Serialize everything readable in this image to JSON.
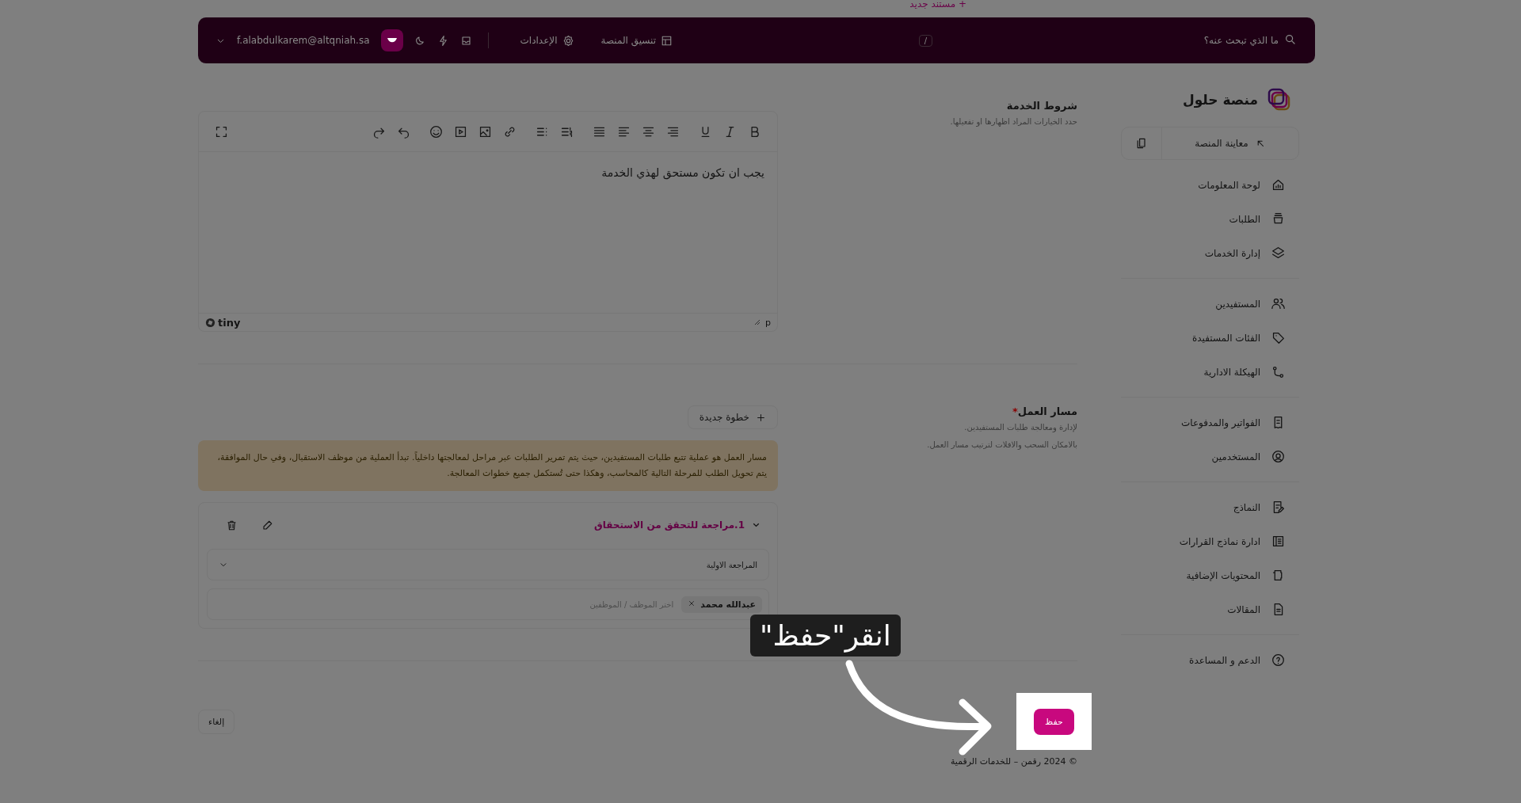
{
  "top_link": {
    "label": "مستند جديد",
    "icon": "+"
  },
  "topbar": {
    "search_placeholder": "ما الذي تبحث عنه؟",
    "shortcut": "/",
    "links": [
      {
        "label": "تنسيق المنصة",
        "kind": "layout"
      },
      {
        "label": "الإعدادات",
        "kind": "settings"
      }
    ],
    "email": "f.alabdulkarem@altqniah.sa"
  },
  "sidebar": {
    "brand": "منصة حلول",
    "preview": "معاينة المنصة",
    "groups": [
      [
        {
          "label": "لوحة المعلومات",
          "kind": "dashboard"
        },
        {
          "label": "الطلبات",
          "kind": "requests"
        },
        {
          "label": "إدارة الخدمات",
          "kind": "services"
        }
      ],
      [
        {
          "label": "المستفيدين",
          "kind": "users"
        },
        {
          "label": "الفئات المستفيدة",
          "kind": "tag"
        },
        {
          "label": "الهيكلة الادارية",
          "kind": "structure"
        }
      ],
      [
        {
          "label": "الفواتير والمدفوعات",
          "kind": "invoice"
        },
        {
          "label": "المستخدمين",
          "kind": "user"
        }
      ],
      [
        {
          "label": "النماذج",
          "kind": "forms"
        },
        {
          "label": "ادارة نماذج القرارات",
          "kind": "decisions"
        },
        {
          "label": "المحتويات الإضافية",
          "kind": "content"
        },
        {
          "label": "المقالات",
          "kind": "articles"
        }
      ],
      [
        {
          "label": "الدعم و المساعدة",
          "kind": "help"
        }
      ]
    ]
  },
  "terms": {
    "title": "شروط الخدمة",
    "subtitle": "حدد الخيارات المراد اظهارها او تفعيلها.",
    "content": "يجب ان تكون مستحق لهذي الخدمة",
    "status_path": "p",
    "brand": "tiny"
  },
  "workflow": {
    "title": "مسار العمل",
    "required_mark": "*",
    "subtitle_lines": [
      "لإدارة ومعالجة طلبات المستفيدين.",
      "بالامكان السحب والافلات لترتيب مسار العمل."
    ],
    "add_button": "خطوة جديدة",
    "notice": "مسار العمل هو عملية تتبع طلبات المستفيدين، حيث يتم تمرير الطلبات عبر مراحل لمعالجتها داخلياً. تبدأ العملية من موظف الاستقبال، وفي حال الموافقة، يتم تحويل الطلب للمرحلة التالية كالمحاسب، وهكذا حتى تُستكمل جميع خطوات المعالجة.",
    "steps": [
      {
        "title": "1.مراجعة للتحقق من الاستحقاق",
        "expanded": true,
        "stage": "المراجعة الاولية",
        "assignees": [
          "عبدالله محمد"
        ],
        "assignee_placeholder": "اختر الموظف / الموظفين"
      }
    ]
  },
  "actions": {
    "save": "حفظ",
    "cancel": "إلغاء"
  },
  "footer": "© 2024 رقمن – للخدمات الرقمية",
  "tutorial": {
    "callout": "انقر\"حفظ\""
  }
}
